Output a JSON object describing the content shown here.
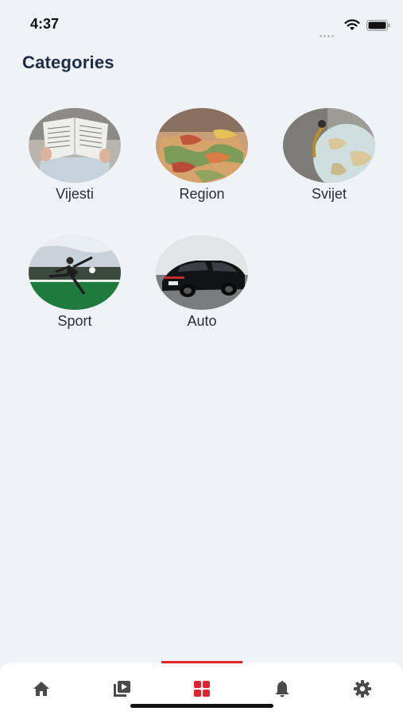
{
  "status_bar": {
    "time": "4:37",
    "icons": [
      "signal-dots-icon",
      "wifi-icon",
      "battery-icon"
    ]
  },
  "page": {
    "title": "Categories"
  },
  "categories": [
    {
      "label": "Vijesti",
      "image": "newspaper-reader-photo"
    },
    {
      "label": "Region",
      "image": "colorful-map-photo"
    },
    {
      "label": "Svijet",
      "image": "globe-photo"
    },
    {
      "label": "Sport",
      "image": "soccer-player-photo"
    },
    {
      "label": "Auto",
      "image": "black-car-photo"
    }
  ],
  "tab_bar": {
    "tabs": [
      {
        "icon": "home-icon",
        "active": false
      },
      {
        "icon": "video-play-icon",
        "active": false
      },
      {
        "icon": "grid-icon",
        "active": true
      },
      {
        "icon": "bell-icon",
        "active": false
      },
      {
        "icon": "gear-icon",
        "active": false
      }
    ],
    "accent": "#e0242b",
    "inactive_color": "#4a4a4a"
  }
}
